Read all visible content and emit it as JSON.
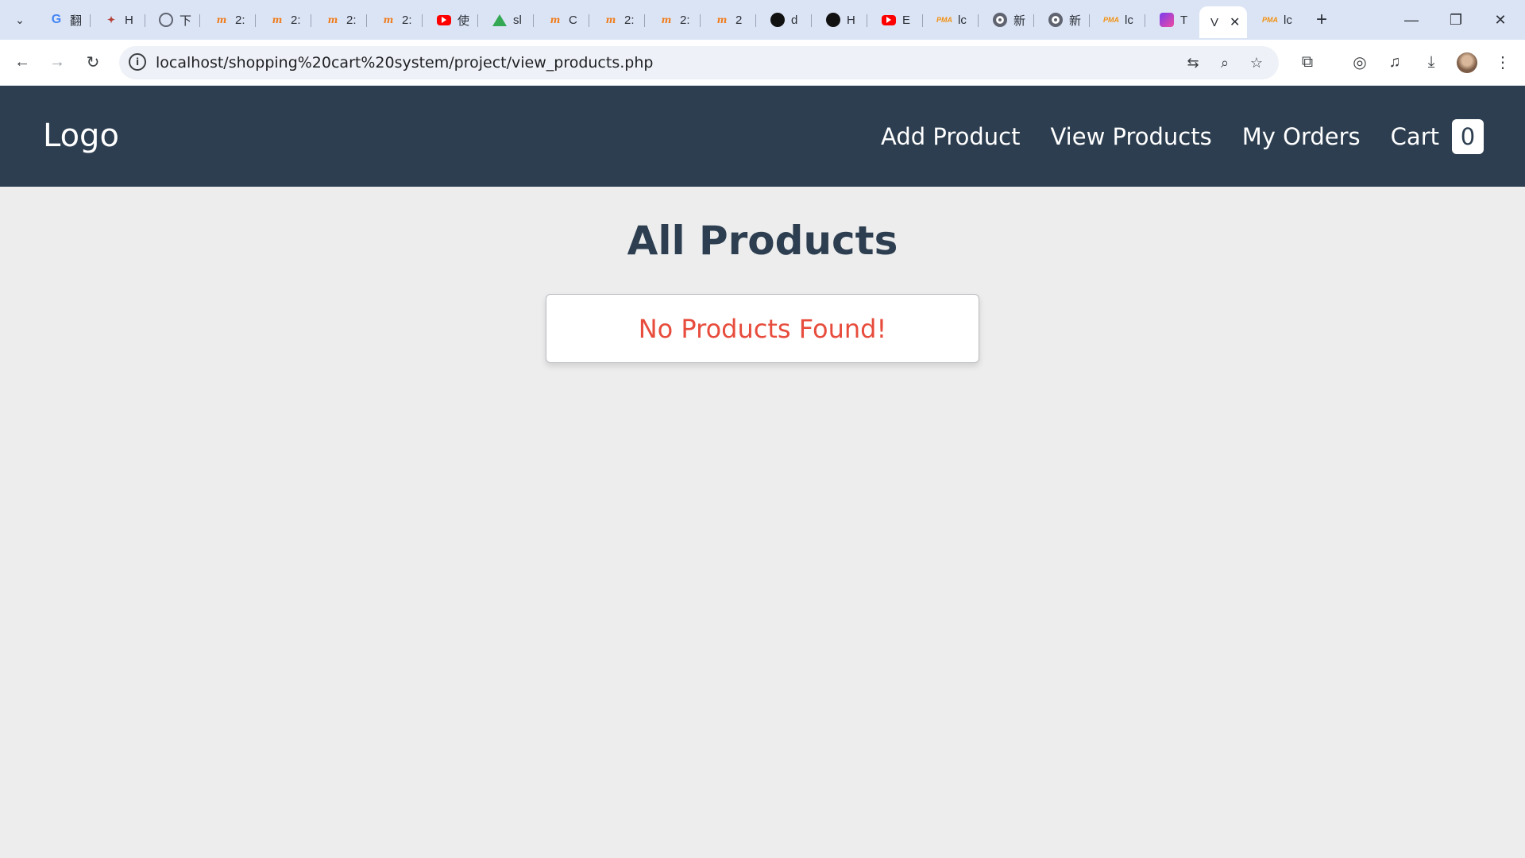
{
  "browser": {
    "tabs": [
      {
        "icon": "google-icon",
        "title": "翻"
      },
      {
        "icon": "hacker-icon",
        "title": "H"
      },
      {
        "icon": "globe-icon",
        "title": "下"
      },
      {
        "icon": "moodle-icon",
        "title": "2:"
      },
      {
        "icon": "moodle-icon",
        "title": "2:"
      },
      {
        "icon": "moodle-icon",
        "title": "2:"
      },
      {
        "icon": "moodle-icon",
        "title": "2:"
      },
      {
        "icon": "youtube-icon",
        "title": "使"
      },
      {
        "icon": "google-drive-icon",
        "title": "sl"
      },
      {
        "icon": "moodle-icon",
        "title": "C"
      },
      {
        "icon": "moodle-icon",
        "title": "2:"
      },
      {
        "icon": "moodle-icon",
        "title": "2:"
      },
      {
        "icon": "moodle-icon",
        "title": "2"
      },
      {
        "icon": "github-icon",
        "title": "d"
      },
      {
        "icon": "github-icon",
        "title": "H"
      },
      {
        "icon": "youtube-icon",
        "title": "E"
      },
      {
        "icon": "phpmyadmin-icon",
        "title": "lc"
      },
      {
        "icon": "chrome-icon",
        "title": "新"
      },
      {
        "icon": "chrome-icon",
        "title": "新"
      },
      {
        "icon": "phpmyadmin-icon",
        "title": "lc"
      },
      {
        "icon": "tools-icon",
        "title": "T"
      },
      {
        "icon": "",
        "title": "V",
        "active": true
      },
      {
        "icon": "phpmyadmin-icon",
        "title": "lc"
      }
    ],
    "url": "localhost/shopping%20cart%20system/project/view_products.php"
  },
  "navbar": {
    "logo": "Logo",
    "links": {
      "add_product": "Add Product",
      "view_products": "View Products",
      "my_orders": "My Orders",
      "cart": "Cart"
    },
    "cart_count": "0"
  },
  "main": {
    "heading": "All Products",
    "empty_message": "No Products Found!"
  },
  "colors": {
    "navbar_bg": "#2c3e50",
    "page_bg": "#ededed",
    "empty_message": "#e74c3c"
  }
}
